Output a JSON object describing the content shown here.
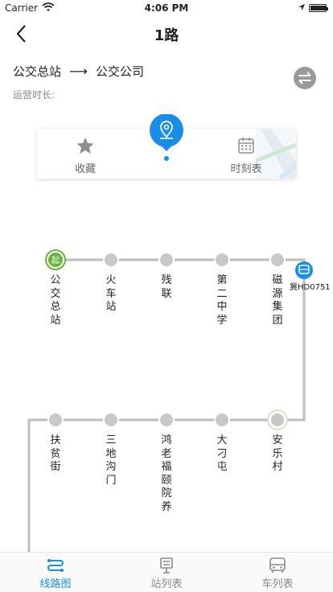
{
  "status_bar": {
    "carrier": "Carrier",
    "time": "4:06 PM"
  },
  "nav": {
    "title": "1路"
  },
  "route": {
    "start": "公交总站",
    "arrow": "⟶",
    "end": "公交公司",
    "duration_label": "运营时长:"
  },
  "actions": {
    "favorite": "收藏",
    "timetable": "时刻表"
  },
  "stops": [
    {
      "name": "公交总站",
      "start_badge": "起"
    },
    {
      "name": "火车站"
    },
    {
      "name": "残联"
    },
    {
      "name": "第二中学"
    },
    {
      "name": "磁源集团"
    },
    {
      "name": "安乐村"
    },
    {
      "name": "大刁屯"
    },
    {
      "name": "鸿老福颐院养"
    },
    {
      "name": "三地沟门"
    },
    {
      "name": "扶贫街"
    }
  ],
  "bus": {
    "plate": "冀HD0751"
  },
  "tabs": [
    {
      "label": "线路图",
      "active": true
    },
    {
      "label": "站列表",
      "active": false
    },
    {
      "label": "车列表",
      "active": false
    }
  ],
  "colors": {
    "accent": "#1a8ee6",
    "start_green": "#6ab43e",
    "line_gray": "#bdbdbd",
    "stop_gray": "#c8c8c8"
  }
}
